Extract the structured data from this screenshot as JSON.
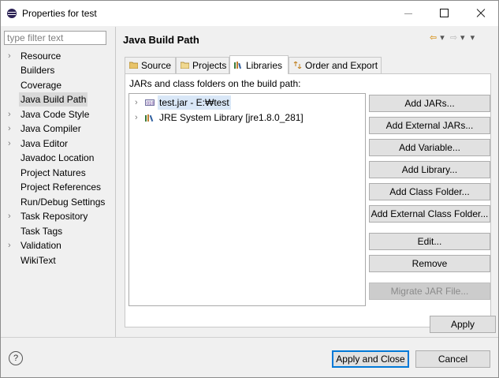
{
  "window": {
    "title": "Properties for test",
    "colors": {
      "selection_bg": "#d9d9d9",
      "tree_selection_bg": "#d9e7f7",
      "default_button_border": "#0078d7"
    }
  },
  "filter": {
    "placeholder": "type filter text",
    "value": ""
  },
  "nav": {
    "items": [
      {
        "label": "Resource",
        "expandable": true,
        "selected": false
      },
      {
        "label": "Builders",
        "expandable": false,
        "selected": false
      },
      {
        "label": "Coverage",
        "expandable": false,
        "selected": false
      },
      {
        "label": "Java Build Path",
        "expandable": false,
        "selected": true
      },
      {
        "label": "Java Code Style",
        "expandable": true,
        "selected": false
      },
      {
        "label": "Java Compiler",
        "expandable": true,
        "selected": false
      },
      {
        "label": "Java Editor",
        "expandable": true,
        "selected": false
      },
      {
        "label": "Javadoc Location",
        "expandable": false,
        "selected": false
      },
      {
        "label": "Project Natures",
        "expandable": false,
        "selected": false
      },
      {
        "label": "Project References",
        "expandable": false,
        "selected": false
      },
      {
        "label": "Run/Debug Settings",
        "expandable": false,
        "selected": false
      },
      {
        "label": "Task Repository",
        "expandable": true,
        "selected": false
      },
      {
        "label": "Task Tags",
        "expandable": false,
        "selected": false
      },
      {
        "label": "Validation",
        "expandable": true,
        "selected": false
      },
      {
        "label": "WikiText",
        "expandable": false,
        "selected": false
      }
    ]
  },
  "page": {
    "title": "Java Build Path"
  },
  "tabs": [
    {
      "label": "Source",
      "icon": "source-folder-icon",
      "active": false
    },
    {
      "label": "Projects",
      "icon": "projects-folder-icon",
      "active": false
    },
    {
      "label": "Libraries",
      "icon": "libraries-icon",
      "active": true
    },
    {
      "label": "Order and Export",
      "icon": "order-export-icon",
      "active": false
    }
  ],
  "libraries": {
    "description": "JARs and class folders on the build path:",
    "entries": [
      {
        "label": "test.jar - E:₩test",
        "icon": "jar-icon",
        "selected": true
      },
      {
        "label": "JRE System Library [jre1.8.0_281]",
        "icon": "library-icon",
        "selected": false
      }
    ],
    "buttons": {
      "add_jars": "Add JARs...",
      "add_external_jars": "Add External JARs...",
      "add_variable": "Add Variable...",
      "add_library": "Add Library...",
      "add_class_folder": "Add Class Folder...",
      "add_external_class_folder": "Add External Class Folder...",
      "edit": "Edit...",
      "remove": "Remove",
      "migrate_jar": "Migrate JAR File..."
    }
  },
  "footer": {
    "apply": "Apply",
    "apply_and_close": "Apply and Close",
    "cancel": "Cancel",
    "help_glyph": "?"
  }
}
